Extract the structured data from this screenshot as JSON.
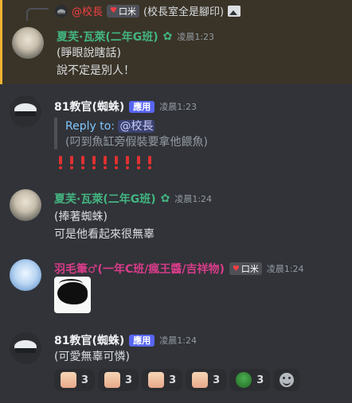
{
  "messages": [
    {
      "reply": {
        "name": "@校長",
        "tag": "口米",
        "text": "(校長室全是腳印)"
      },
      "author": "夏芙·瓦萊(二年G班)",
      "time": "凌晨1:23",
      "lines": [
        "(睜眼說瞎話)",
        "說不定是別人！"
      ]
    },
    {
      "author": "81教官(蜘蛛)",
      "badge": "應用",
      "time": "凌晨1:23",
      "quote": {
        "reply_to": "Reply to:",
        "mention": "@校長",
        "text": "(叼到魚缸旁假裝要拿他餵魚)"
      },
      "exclaim_count": 9
    },
    {
      "author": "夏芙·瓦萊(二年G班)",
      "time": "凌晨1:24",
      "lines": [
        "(捧著蜘蛛)",
        "可是他看起來很無辜"
      ]
    },
    {
      "author": "羽毛筆♂(一年C班/瘋王醬/吉祥物)",
      "tag": "口米",
      "time": "凌晨1:24"
    },
    {
      "author": "81教官(蜘蛛)",
      "badge": "應用",
      "time": "凌晨1:24",
      "lines": [
        "(可愛無辜可憐)"
      ],
      "reactions": [
        {
          "emoji": "face-emoji",
          "count": "3"
        },
        {
          "emoji": "face-emoji",
          "count": "3"
        },
        {
          "emoji": "face-emoji",
          "count": "3"
        },
        {
          "emoji": "face-emoji",
          "count": "3"
        },
        {
          "emoji": "frog-emoji",
          "count": "3"
        }
      ]
    }
  ],
  "colors": {
    "background": "#313338",
    "highlight": "#3a3428",
    "green_name": "#43b581",
    "pink_name": "#d83c8a",
    "app_badge": "#5865f2"
  }
}
